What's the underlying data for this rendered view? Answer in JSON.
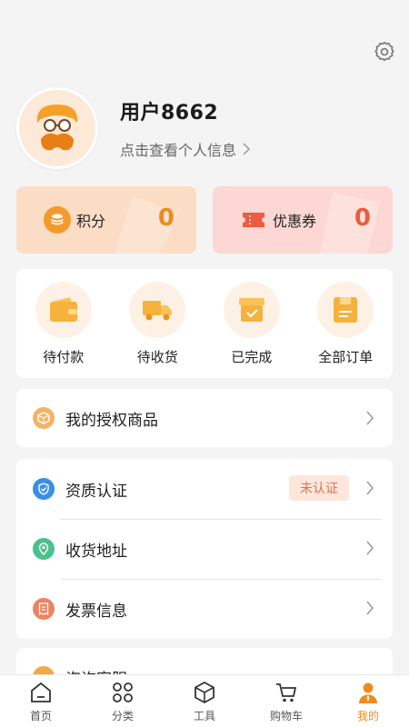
{
  "profile": {
    "name": "用户8662",
    "subtitle": "点击查看个人信息",
    "avatar_icon": "mustache-avatar-icon"
  },
  "cards": [
    {
      "label": "积分",
      "value": "0",
      "icon": "coin-icon"
    },
    {
      "label": "优惠券",
      "value": "0",
      "icon": "ticket-icon"
    }
  ],
  "orders": [
    {
      "label": "待付款",
      "icon": "wallet-icon"
    },
    {
      "label": "待收货",
      "icon": "truck-icon"
    },
    {
      "label": "已完成",
      "icon": "box-check-icon"
    },
    {
      "label": "全部订单",
      "icon": "order-list-icon"
    }
  ],
  "authorized": {
    "label": "我的授权商品",
    "icon": "package-icon"
  },
  "menu": [
    {
      "label": "资质认证",
      "badge": "未认证",
      "icon": "shield-check-icon"
    },
    {
      "label": "收货地址",
      "icon": "location-icon"
    },
    {
      "label": "发票信息",
      "icon": "invoice-icon"
    }
  ],
  "partial_row": {
    "label": "咨询客服"
  },
  "tabs": [
    {
      "label": "首页",
      "icon": "home-icon"
    },
    {
      "label": "分类",
      "icon": "category-icon"
    },
    {
      "label": "工具",
      "icon": "cube-icon"
    },
    {
      "label": "购物车",
      "icon": "cart-icon"
    },
    {
      "label": "我的",
      "icon": "person-icon",
      "active": true
    }
  ],
  "colors": {
    "accent": "#f08a1c",
    "coupon": "#ef5b3c",
    "background": "#f4f4f4"
  }
}
